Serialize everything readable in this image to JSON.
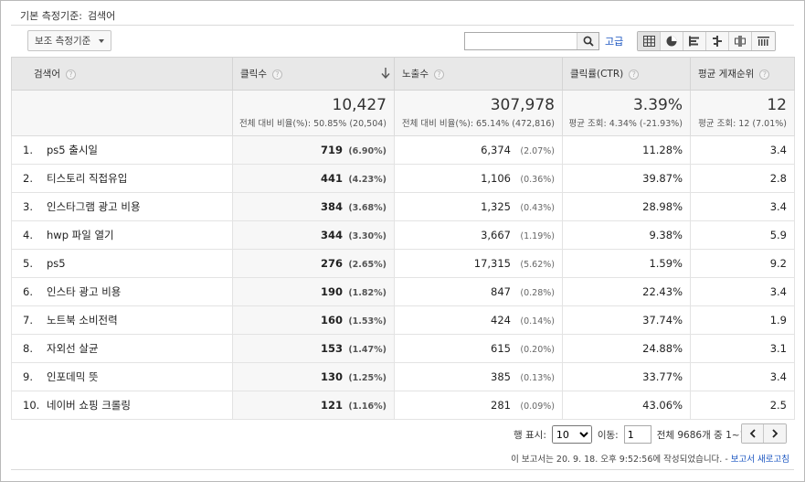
{
  "primary_dimension": {
    "label": "기본 측정기준:",
    "value": "검색어"
  },
  "secondary_dimension_label": "보조 측정기준",
  "search": {
    "placeholder": "",
    "value": ""
  },
  "advanced_label": "고급",
  "columns": {
    "keyword": "검색어",
    "clicks": "클릭수",
    "impressions": "노출수",
    "ctr": "클릭률(CTR)",
    "position": "평균 게재순위"
  },
  "totals": {
    "clicks": {
      "value": "10,427",
      "sub": "전체 대비 비율(%): 50.85% (20,504)"
    },
    "impressions": {
      "value": "307,978",
      "sub": "전체 대비 비율(%): 65.14% (472,816)"
    },
    "ctr": {
      "value": "3.39%",
      "sub": "평균 조회: 4.34% (-21.93%)"
    },
    "position": {
      "value": "12",
      "sub": "평균 조회: 12 (7.01%)"
    }
  },
  "rows": [
    {
      "idx": "1.",
      "keyword": "ps5 출시일",
      "clicks": "719",
      "clicks_pct": "(6.90%)",
      "impressions": "6,374",
      "impressions_pct": "(2.07%)",
      "ctr": "11.28%",
      "position": "3.4"
    },
    {
      "idx": "2.",
      "keyword": "티스토리 직접유입",
      "clicks": "441",
      "clicks_pct": "(4.23%)",
      "impressions": "1,106",
      "impressions_pct": "(0.36%)",
      "ctr": "39.87%",
      "position": "2.8"
    },
    {
      "idx": "3.",
      "keyword": "인스타그램 광고 비용",
      "clicks": "384",
      "clicks_pct": "(3.68%)",
      "impressions": "1,325",
      "impressions_pct": "(0.43%)",
      "ctr": "28.98%",
      "position": "3.4"
    },
    {
      "idx": "4.",
      "keyword": "hwp 파일 열기",
      "clicks": "344",
      "clicks_pct": "(3.30%)",
      "impressions": "3,667",
      "impressions_pct": "(1.19%)",
      "ctr": "9.38%",
      "position": "5.9"
    },
    {
      "idx": "5.",
      "keyword": "ps5",
      "clicks": "276",
      "clicks_pct": "(2.65%)",
      "impressions": "17,315",
      "impressions_pct": "(5.62%)",
      "ctr": "1.59%",
      "position": "9.2"
    },
    {
      "idx": "6.",
      "keyword": "인스타 광고 비용",
      "clicks": "190",
      "clicks_pct": "(1.82%)",
      "impressions": "847",
      "impressions_pct": "(0.28%)",
      "ctr": "22.43%",
      "position": "3.4"
    },
    {
      "idx": "7.",
      "keyword": "노트북 소비전력",
      "clicks": "160",
      "clicks_pct": "(1.53%)",
      "impressions": "424",
      "impressions_pct": "(0.14%)",
      "ctr": "37.74%",
      "position": "1.9"
    },
    {
      "idx": "8.",
      "keyword": "자외선 살균",
      "clicks": "153",
      "clicks_pct": "(1.47%)",
      "impressions": "615",
      "impressions_pct": "(0.20%)",
      "ctr": "24.88%",
      "position": "3.1"
    },
    {
      "idx": "9.",
      "keyword": "인포데믹 뜻",
      "clicks": "130",
      "clicks_pct": "(1.25%)",
      "impressions": "385",
      "impressions_pct": "(0.13%)",
      "ctr": "33.77%",
      "position": "3.4"
    },
    {
      "idx": "10.",
      "keyword": "네이버 쇼핑 크롤링",
      "clicks": "121",
      "clicks_pct": "(1.16%)",
      "impressions": "281",
      "impressions_pct": "(0.09%)",
      "ctr": "43.06%",
      "position": "2.5"
    }
  ],
  "pagination": {
    "rows_label": "행 표시:",
    "rows_value": "10",
    "goto_label": "이동:",
    "goto_value": "1",
    "range_text": "전체 9686개 중 1~10"
  },
  "footer": {
    "note": "이 보고서는 20. 9. 18. 오후 9:52:56에 작성되었습니다. - ",
    "refresh_link": "보고서 새로고침"
  },
  "icons": {
    "search": "search-icon",
    "views": [
      "table-icon",
      "pie-chart-icon",
      "performance-bar-icon",
      "comparison-icon",
      "pivot-icon",
      "term-cloud-icon"
    ]
  },
  "colors": {
    "link": "#1a55c0",
    "header_bg": "#e8e8e8"
  }
}
